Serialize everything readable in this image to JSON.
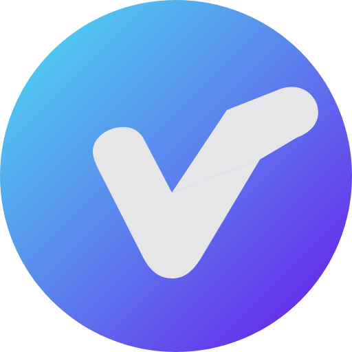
{
  "logo": {
    "icon": "checkmark-icon",
    "shape": "circle",
    "colors": {
      "gradient_start": "#4BE0F0",
      "gradient_mid": "#5A8BEE",
      "gradient_end": "#6A12EA",
      "mark": "#E6E6E8",
      "background": "#FFFFFF"
    }
  }
}
